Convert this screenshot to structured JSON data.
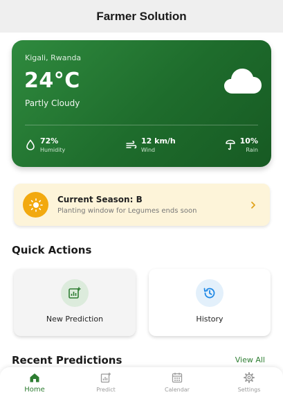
{
  "app_bar": {
    "title": "Farmer Solution"
  },
  "weather": {
    "location": "Kigali, Rwanda",
    "temperature": "24°C",
    "condition": "Partly Cloudy",
    "condition_icon": "cloud-icon",
    "stats": [
      {
        "icon": "humidity-icon",
        "value": "72%",
        "label": "Humidity"
      },
      {
        "icon": "wind-icon",
        "value": "12 km/h",
        "label": "Wind"
      },
      {
        "icon": "rain-icon",
        "value": "10%",
        "label": "Rain"
      }
    ],
    "card_color": "#1e6c2c"
  },
  "season": {
    "title": "Current Season: B",
    "subtitle": "Planting window for Legumes ends soon",
    "icon": "sun-icon",
    "accent": "#f2a90f",
    "background": "#fdf4d9"
  },
  "quick_actions": {
    "title": "Quick Actions",
    "items": [
      {
        "icon": "prediction-icon",
        "label": "New Prediction"
      },
      {
        "icon": "history-icon",
        "label": "History"
      }
    ]
  },
  "recent_predictions": {
    "title": "Recent Predictions",
    "view_all": "View All"
  },
  "bottom_nav": {
    "active": "Home",
    "items": [
      {
        "icon": "home-icon",
        "label": "Home"
      },
      {
        "icon": "predict-icon",
        "label": "Predict"
      },
      {
        "icon": "calendar-icon",
        "label": "Calendar"
      },
      {
        "icon": "settings-icon",
        "label": "Settings"
      }
    ]
  },
  "colors": {
    "primary": "#2e7d32",
    "history_accent": "#1e88e5"
  }
}
